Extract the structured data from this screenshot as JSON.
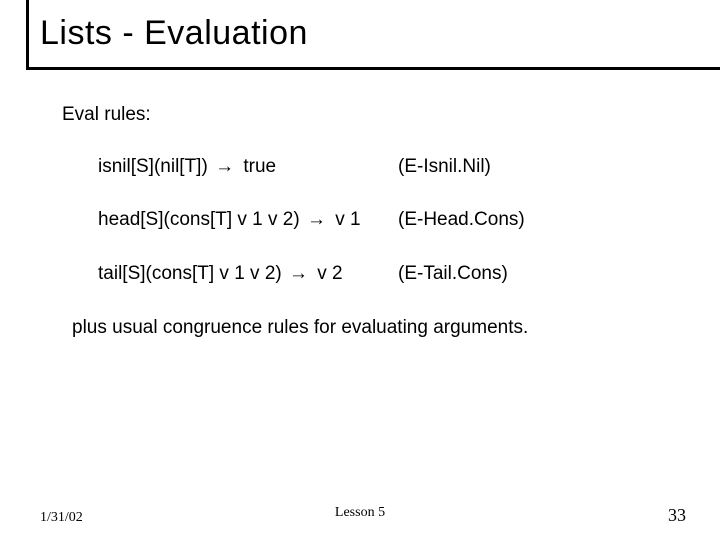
{
  "title": "Lists - Evaluation",
  "subhead": "Eval rules:",
  "rules": [
    {
      "left_a": "isnil[S](nil[T]) ",
      "arrow": "→",
      "left_b": " true",
      "right": "(E-Isnil.Nil)"
    },
    {
      "left_a": "head[S](cons[T] v 1 v 2) ",
      "arrow": "→",
      "left_b": " v 1",
      "right": "(E-Head.Cons)"
    },
    {
      "left_a": "tail[S](cons[T] v 1 v 2) ",
      "arrow": "→",
      "left_b": " v 2",
      "right": "(E-Tail.Cons)"
    }
  ],
  "note": "plus usual congruence rules for evaluating arguments.",
  "footer": {
    "date": "1/31/02",
    "lesson": "Lesson 5",
    "page": "33"
  }
}
